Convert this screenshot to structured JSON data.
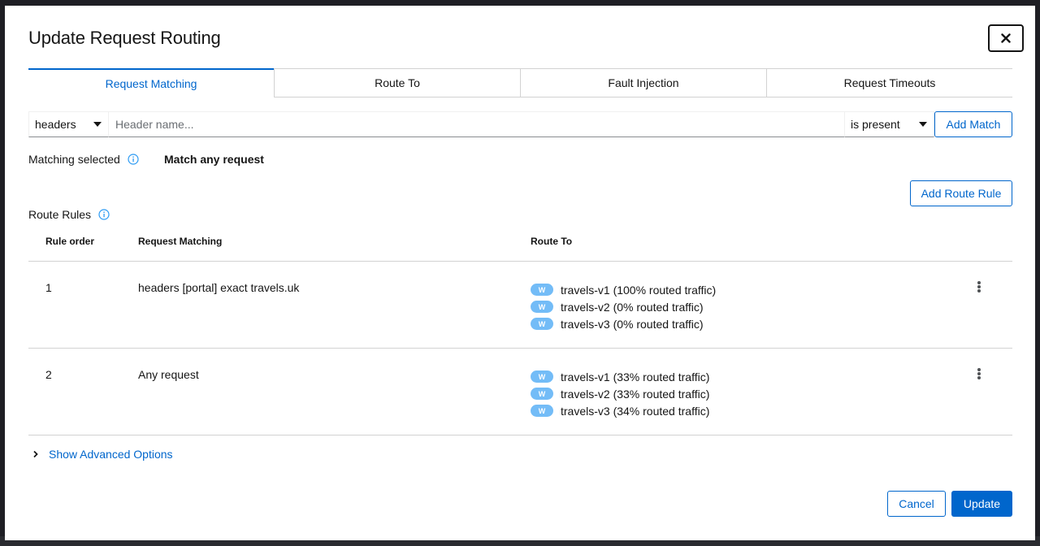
{
  "modal": {
    "title": "Update Request Routing",
    "close_icon": "close-icon"
  },
  "tabs": [
    {
      "label": "Request Matching",
      "active": true
    },
    {
      "label": "Route To",
      "active": false
    },
    {
      "label": "Fault Injection",
      "active": false
    },
    {
      "label": "Request Timeouts",
      "active": false
    }
  ],
  "match_builder": {
    "type_select": "headers",
    "header_placeholder": "Header name...",
    "header_value": "",
    "operator_select": "is present",
    "add_match_label": "Add Match"
  },
  "matching": {
    "label": "Matching selected",
    "value": "Match any request"
  },
  "add_route_rule_label": "Add Route Rule",
  "route_rules": {
    "label": "Route Rules",
    "columns": [
      "Rule order",
      "Request Matching",
      "Route To"
    ],
    "rows": [
      {
        "order": "1",
        "matching": "headers [portal] exact travels.uk",
        "routes": [
          {
            "badge": "W",
            "text": "travels-v1 (100% routed traffic)"
          },
          {
            "badge": "W",
            "text": "travels-v2 (0% routed traffic)"
          },
          {
            "badge": "W",
            "text": "travels-v3 (0% routed traffic)"
          }
        ]
      },
      {
        "order": "2",
        "matching": "Any request",
        "routes": [
          {
            "badge": "W",
            "text": "travels-v1 (33% routed traffic)"
          },
          {
            "badge": "W",
            "text": "travels-v2 (33% routed traffic)"
          },
          {
            "badge": "W",
            "text": "travels-v3 (34% routed traffic)"
          }
        ]
      }
    ]
  },
  "advanced_options_label": "Show Advanced Options",
  "footer": {
    "cancel_label": "Cancel",
    "update_label": "Update"
  },
  "colors": {
    "primary": "#0066cc",
    "badge": "#73bcf7",
    "border": "#d2d2d2"
  }
}
